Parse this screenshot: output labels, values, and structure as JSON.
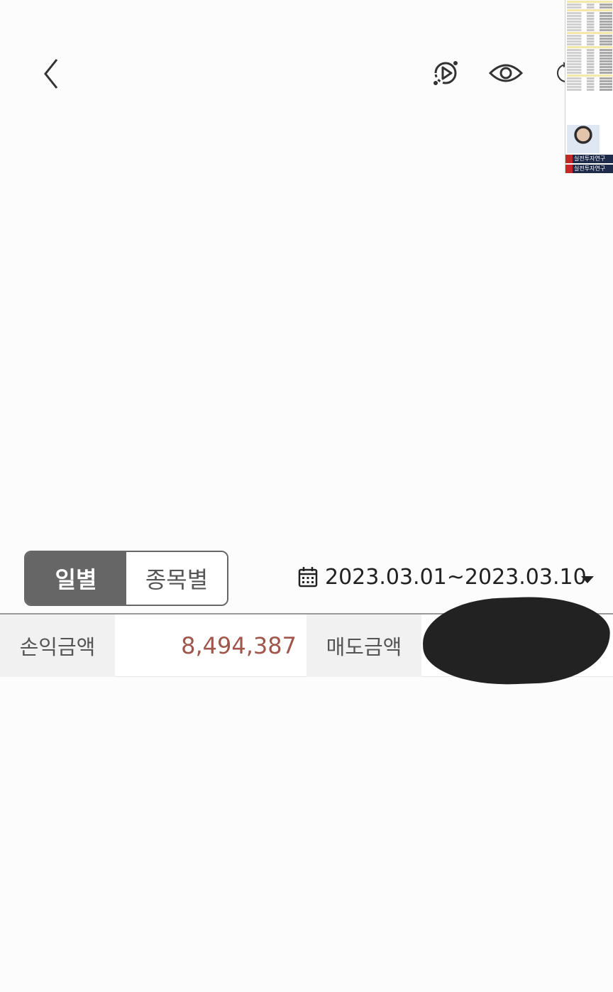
{
  "topbar": {
    "back_icon": "chevron-left-icon",
    "replay_icon": "replay-play-icon",
    "eye_icon": "eye-icon",
    "rotate_icon": "rotate-icon"
  },
  "thumbnail": {
    "banner_text": "실전투자연구"
  },
  "tabs": {
    "daily": "일별",
    "by_stock": "종목별",
    "selected": "daily"
  },
  "date_range": {
    "icon": "calendar-icon",
    "text": "2023.03.01~2023.03.10",
    "dropdown_icon": "caret-down-icon"
  },
  "summary": {
    "profit_label": "손익금액",
    "profit_value": "8,494,387",
    "sell_label": "매도금액",
    "sell_value": ""
  },
  "colors": {
    "accent_dark": "#666666",
    "profit_text": "#a0564b",
    "label_bg": "#f1f1f1",
    "background": "#fcfcfc"
  }
}
